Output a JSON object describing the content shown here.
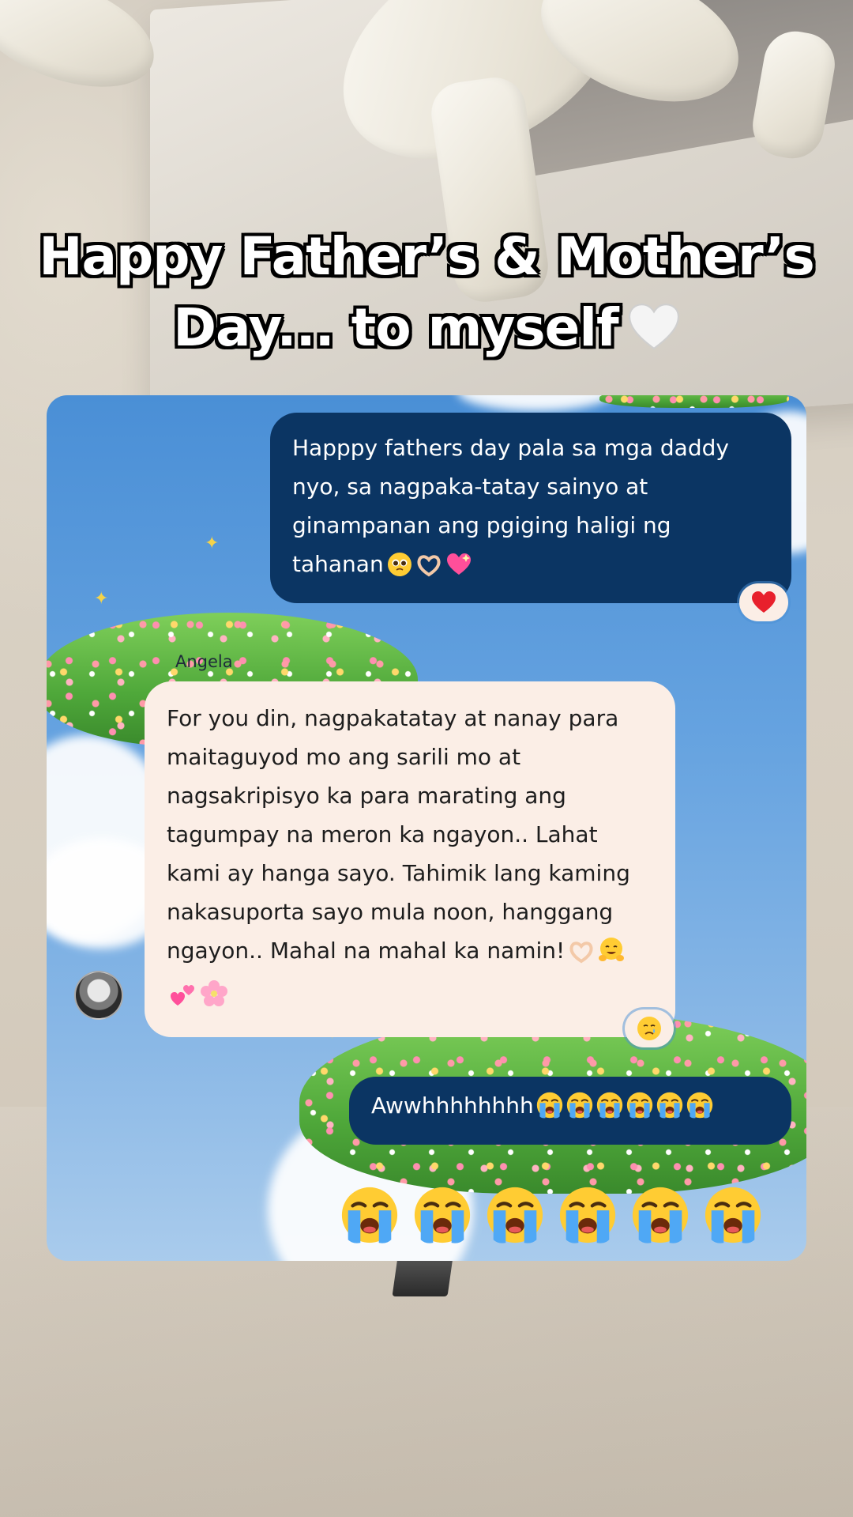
{
  "title": {
    "line1": "Happy Father’s & Mother’s",
    "line2": "Day... to myself"
  },
  "chat": {
    "messages": [
      {
        "direction": "outgoing",
        "text": "Happpy fathers day pala sa mga daddy nyo, sa nagpaka-tatay sainyo at ginampanan ang pgiging haligi ng tahanan",
        "reaction": "heart"
      },
      {
        "direction": "incoming",
        "sender": "Angela",
        "text": "For you din, nagpakatatay at nanay para maitaguyod mo ang sarili mo at nagsakripisyo ka para marating ang tagumpay na meron ka ngayon.. Lahat kami ay hanga sayo. Tahimik lang kaming nakasuporta sayo mula noon, hanggang ngayon.. Mahal na mahal ka namin!",
        "reaction": "crying-face"
      },
      {
        "direction": "outgoing",
        "text": "Awwhhhhhhhh",
        "trailing_emoji_count": 6
      }
    ]
  },
  "overlay_emoji_count": 6,
  "colors": {
    "outgoing_bubble": "#0b3563",
    "incoming_bubble": "#fbeee6",
    "title_fill": "#ffffff",
    "title_outline": "#000000"
  }
}
